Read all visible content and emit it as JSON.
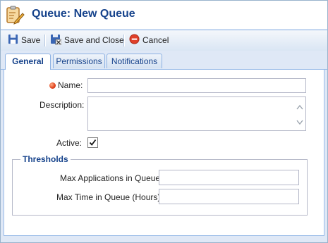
{
  "window": {
    "title": "Queue: New Queue",
    "title_icon": "clipboard-edit-icon"
  },
  "toolbar": {
    "save_label": "Save",
    "save_close_label": "Save and Close",
    "cancel_label": "Cancel"
  },
  "tabs": [
    {
      "label": "General",
      "active": true
    },
    {
      "label": "Permissions",
      "active": false
    },
    {
      "label": "Notifications",
      "active": false
    }
  ],
  "form": {
    "name_label": "Name:",
    "name_value": "",
    "description_label": "Description:",
    "description_value": "",
    "active_label": "Active:",
    "active_checked": true
  },
  "thresholds": {
    "legend": "Thresholds",
    "max_apps_label": "Max Applications in Queue:",
    "max_apps_value": "",
    "max_time_label": "Max Time in Queue (Hours):",
    "max_time_value": ""
  },
  "colors": {
    "accent": "#15428b",
    "border": "#99bbe8",
    "required": "#e0401a"
  }
}
